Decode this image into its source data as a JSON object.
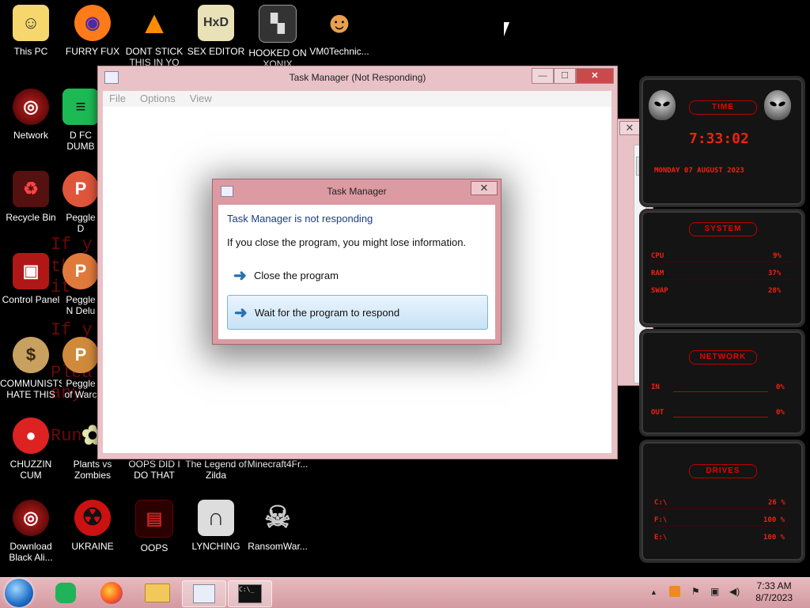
{
  "desktop": {
    "icons": [
      {
        "label": "This PC",
        "glyph": "☺",
        "color": "#f5d76e"
      },
      {
        "label": "FURRY FUX",
        "glyph": "◉",
        "color": "#ff7a18"
      },
      {
        "label": "DONT STICK THIS IN YO",
        "glyph": "▲",
        "color": "#ff8c00"
      },
      {
        "label": "SEX EDITOR",
        "glyph": "HxD",
        "color": "#b8b87a"
      },
      {
        "label": "HOOKED ON XONIX",
        "glyph": "▚",
        "color": "#cccccc"
      },
      {
        "label": "VM0Technic...",
        "glyph": "☻",
        "color": "#e8a050"
      },
      {
        "label": "Network",
        "glyph": "◎",
        "color": "#9a1010"
      },
      {
        "label": "D FC DUMB",
        "glyph": "≡",
        "color": "#1db954"
      },
      {
        "label": "Recycle Bin",
        "glyph": "♻",
        "color": "#cc2222"
      },
      {
        "label": "Peggle D",
        "glyph": "P",
        "color": "#e0563b"
      },
      {
        "label": "Control Panel",
        "glyph": "▣",
        "color": "#b01818"
      },
      {
        "label": "Peggle N Delu",
        "glyph": "P",
        "color": "#e07a3b"
      },
      {
        "label": "COMMUNISTS HATE THIS G...",
        "glyph": "$",
        "color": "#c8a060"
      },
      {
        "label": "Peggle of Warc",
        "glyph": "P",
        "color": "#d08a3b"
      },
      {
        "label": "CHUZZIN CUM",
        "glyph": "●",
        "color": "#dd2222"
      },
      {
        "label": "Plants vs Zombies",
        "glyph": "✿",
        "color": "#e6e6b0"
      },
      {
        "label": "OOPS DID I DO THAT",
        "glyph": "▤",
        "color": "#660000"
      },
      {
        "label": "The Legend of Zilda",
        "glyph": "",
        "color": "#000000"
      },
      {
        "label": "Minecraft4Fr...",
        "glyph": "",
        "color": "#000000"
      },
      {
        "label": "Download Black Ali...",
        "glyph": "◎",
        "color": "#9a1010"
      },
      {
        "label": "UKRAINE",
        "glyph": "☢",
        "color": "#cc1111"
      },
      {
        "label": "OOPS",
        "glyph": "▤",
        "color": "#660000"
      },
      {
        "label": "LYNCHING",
        "glyph": "∩",
        "color": "#dddddd"
      },
      {
        "label": "RansomWar...",
        "glyph": "☠",
        "color": "#cccccc"
      }
    ],
    "bg_text": [
      "If y",
      "the",
      "it",
      "If y",
      "Plea",
      "any",
      "Run"
    ]
  },
  "task_manager": {
    "title": "Task Manager (Not Responding)",
    "menu": [
      "File",
      "Options",
      "View"
    ],
    "minimize": "—",
    "maximize": "☐",
    "close": "✕"
  },
  "side_window": {
    "close": "✕"
  },
  "dialog": {
    "title": "Task Manager",
    "close": "✕",
    "heading": "Task Manager is not responding",
    "message": "If you close the program, you might lose information.",
    "option_close": "Close the program",
    "option_wait": "Wait for the program to respond",
    "arrow": "➜"
  },
  "widget": {
    "time_title": "TIME",
    "time_value": "7:33:02",
    "date_value": "MONDAY 07 AUGUST 2023",
    "system_title": "SYSTEM",
    "cpu_label": "CPU",
    "cpu_value": "9%",
    "ram_label": "RAM",
    "ram_value": "37%",
    "swap_label": "SWAP",
    "swap_value": "28%",
    "network_title": "NETWORK",
    "in_label": "IN",
    "in_value": "0%",
    "out_label": "OUT",
    "out_value": "0%",
    "drives_title": "DRIVES",
    "drive_c_label": "C:\\",
    "drive_c_value": "26 %",
    "drive_f_label": "F:\\",
    "drive_f_value": "100 %",
    "drive_e_label": "E:\\",
    "drive_e_value": "100 %"
  },
  "taskbar": {
    "tray_up": "▲",
    "clock_time": "7:33 AM",
    "clock_date": "8/7/2023"
  }
}
